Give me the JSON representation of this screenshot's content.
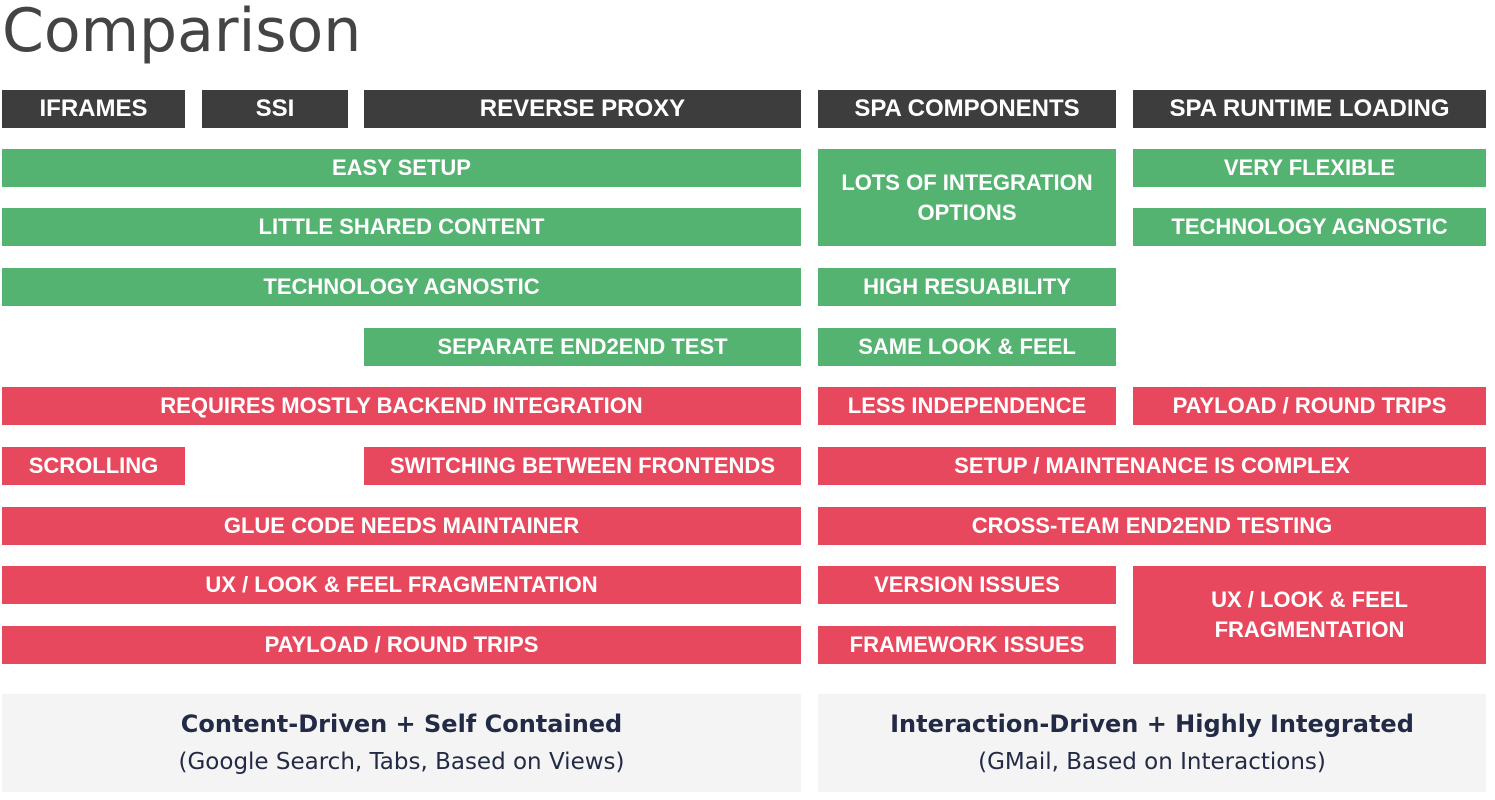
{
  "title": "Comparison",
  "headers": {
    "iframes": "IFRAMES",
    "ssi": "SSI",
    "reverse_proxy": "REVERSE PROXY",
    "spa_components": "SPA COMPONENTS",
    "spa_runtime_loading": "SPA RUNTIME LOADING"
  },
  "pros": {
    "easy_setup": "EASY SETUP",
    "little_shared_content": "LITTLE SHARED CONTENT",
    "technology_agnostic_left": "TECHNOLOGY AGNOSTIC",
    "separate_end2end_test": "SEPARATE END2END TEST",
    "lots_of_integration_options": "LOTS OF INTEGRATION OPTIONS",
    "high_reusability": "HIGH RESUABILITY",
    "same_look_feel": "SAME LOOK & FEEL",
    "very_flexible": "VERY FLEXIBLE",
    "technology_agnostic_right": "TECHNOLOGY AGNOSTIC"
  },
  "cons": {
    "requires_backend_integration": "REQUIRES MOSTLY BACKEND INTEGRATION",
    "scrolling": "SCROLLING",
    "switching_frontends": "SWITCHING BETWEEN FRONTENDS",
    "glue_code": "GLUE CODE NEEDS MAINTAINER",
    "ux_fragmentation_left": "UX / LOOK & FEEL FRAGMENTATION",
    "payload_left": "PAYLOAD / ROUND TRIPS",
    "less_independence": "LESS INDEPENDENCE",
    "payload_right": "PAYLOAD / ROUND TRIPS",
    "setup_maintenance_complex": "SETUP / MAINTENANCE IS COMPLEX",
    "cross_team_testing": "CROSS-TEAM END2END TESTING",
    "version_issues": "VERSION ISSUES",
    "framework_issues": "FRAMEWORK ISSUES",
    "ux_fragmentation_right": "UX / LOOK & FEEL FRAGMENTATION"
  },
  "panels": {
    "left": {
      "heading": "Content-Driven + Self Contained",
      "subtitle": "(Google Search, Tabs, Based on Views)"
    },
    "right": {
      "heading": "Interaction-Driven + Highly Integrated",
      "subtitle": "(GMail, Based on Interactions)"
    }
  },
  "colors": {
    "header": "#3d3d3d",
    "pro": "#54b371",
    "con": "#e8485d",
    "panel": "#f4f4f4",
    "panel_text": "#232a45"
  }
}
